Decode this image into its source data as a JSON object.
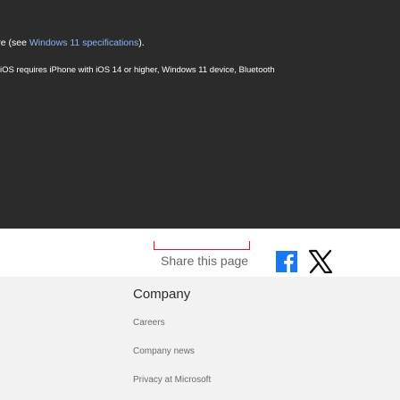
{
  "banner": {
    "hardware_text_prefix": "dware (see ",
    "hardware_link": "Windows 11 specifications",
    "hardware_text_suffix": ").",
    "ios_requirement": "iOS requires iPhone with iOS 14 or higher, Windows 11 device, Bluetooth"
  },
  "share": {
    "label": "Share this page",
    "facebook_icon": "facebook-icon",
    "x_icon": "x-icon",
    "colors": {
      "facebook": "#1877f2",
      "x": "#111111",
      "focus_outline": "#e81123"
    }
  },
  "company": {
    "heading": "Company",
    "links": [
      "Careers",
      "Company news",
      "Privacy at Microsoft"
    ]
  }
}
